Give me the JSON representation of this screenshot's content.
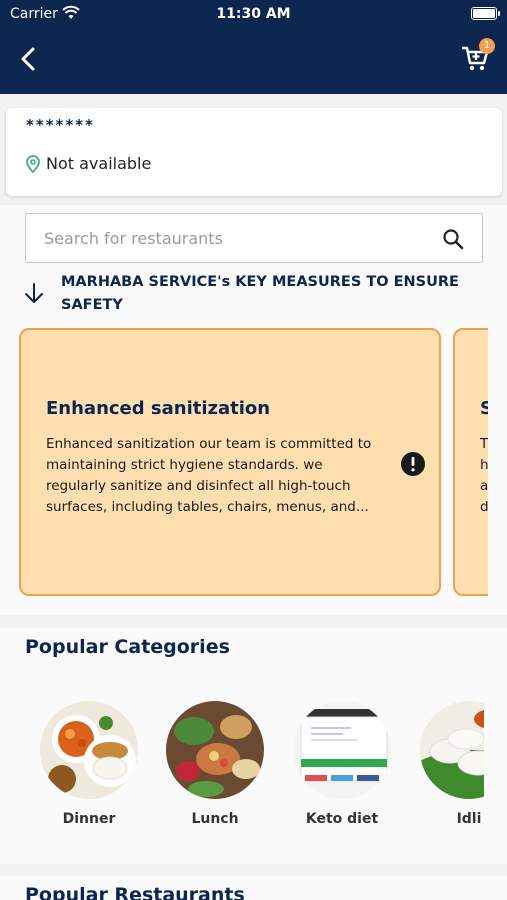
{
  "status_bar": {
    "carrier": "Carrier",
    "time": "11:30 AM"
  },
  "header": {
    "cart_count": "1"
  },
  "address": {
    "name": "*******",
    "location": "Not available"
  },
  "search": {
    "placeholder": "Search for restaurants"
  },
  "safety": {
    "title": "MARHABA SERVICE's KEY MEASURES TO ENSURE SAFETY",
    "cards": [
      {
        "title": "Enhanced sanitization",
        "description": "Enhanced sanitization our team is committed to maintaining strict hygiene standards. we regularly sanitize and disinfect all high-touch surfaces, including tables, chairs, menus, and..."
      },
      {
        "title": "S",
        "description": "T h a d"
      }
    ]
  },
  "categories": {
    "heading": "Popular Categories",
    "items": [
      {
        "label": "Dinner"
      },
      {
        "label": "Lunch"
      },
      {
        "label": "Keto diet"
      },
      {
        "label": "Idli"
      }
    ]
  },
  "restaurants": {
    "heading": "Popular Restaurants"
  },
  "colors": {
    "brand": "#0d2650",
    "card_bg": "#ffdfb0",
    "card_border": "#f0a050",
    "pin": "#3cb371"
  }
}
